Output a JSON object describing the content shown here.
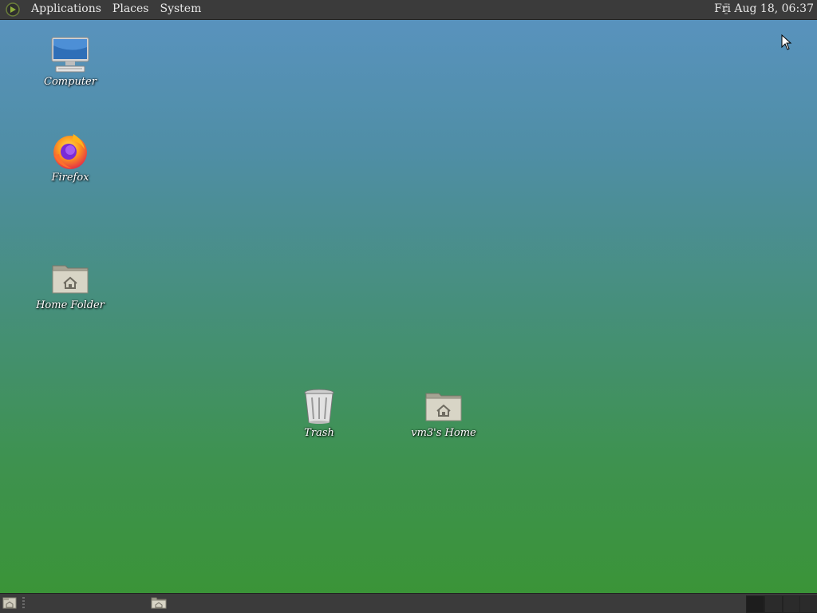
{
  "top_panel": {
    "menus": [
      "Applications",
      "Places",
      "System"
    ],
    "clock": "Fri Aug 18, 06:37"
  },
  "desktop": {
    "icons": [
      {
        "label": "Computer",
        "icon": "computer-monitor-icon"
      },
      {
        "label": "Firefox",
        "icon": "firefox-icon"
      },
      {
        "label": "Home Folder",
        "icon": "home-folder-icon"
      },
      {
        "label": "Trash",
        "icon": "trash-icon"
      },
      {
        "label": "vm3's Home",
        "icon": "home-folder-icon"
      }
    ]
  },
  "bottom_panel": {
    "icons": [
      "show-desktop-icon",
      "home-folder-icon"
    ],
    "workspaces": 4
  }
}
